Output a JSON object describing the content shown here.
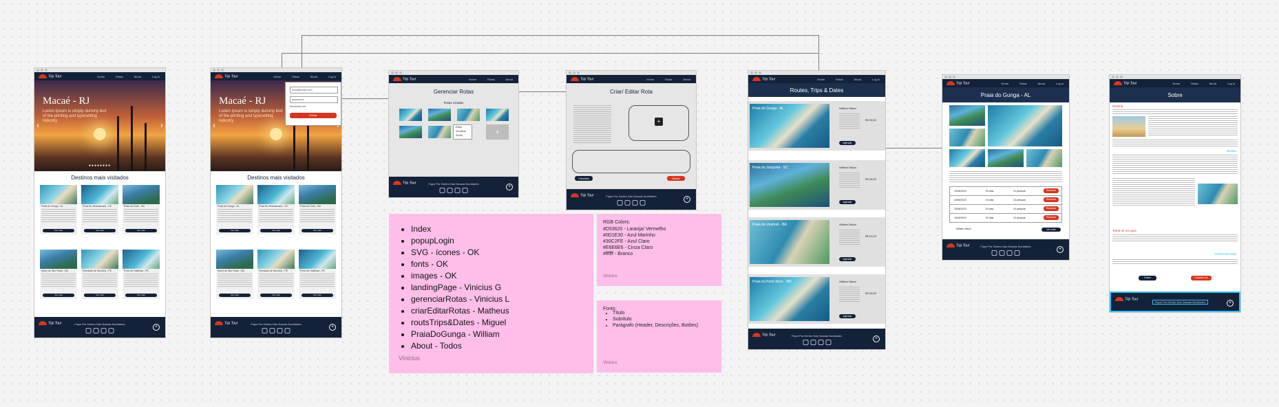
{
  "nav": {
    "home": "Home",
    "routes": "Rotas",
    "about": "About",
    "login": "Log in"
  },
  "footer": {
    "tagline": "Fique Por Dentro Das Nossas Novidades",
    "brand": "Trip Tour",
    "contact": "WhatsApp"
  },
  "landing": {
    "hero_title": "Macaé - RJ",
    "hero_subtitle": "Lorem Ipsum is simply dummy text of the printing and typesetting industry.",
    "section_title": "Destinos mais visitados",
    "cards": [
      {
        "title": "Praia do Gunga - AL"
      },
      {
        "title": "Praia de Jericoacoara - CE"
      },
      {
        "title": "Praia do Forte - BA"
      },
      {
        "title": "Morro de São Paulo - BA"
      },
      {
        "title": "Fernando de Noronha - PE"
      },
      {
        "title": "Porto de Galinhas - PE"
      }
    ],
    "card_button": "Ver mais"
  },
  "login_popup": {
    "email_placeholder": "email@mail.com",
    "password_placeholder": "password",
    "remember": "Remember me",
    "button": "Entrar"
  },
  "manage": {
    "title": "Gerenciar Rotas",
    "subtitle": "Rotas Criadas",
    "menu": [
      "Editar",
      "Visualizar",
      "Excluir"
    ]
  },
  "create": {
    "title": "Criar/ Editar Rota",
    "cancel": "Cancelar",
    "save": "Salvar"
  },
  "routes": {
    "title": "Routes, Trips & Dates",
    "items": [
      {
        "name": "Praia do Gunga - AL",
        "guide": "William Nilson",
        "price": "R$ 250,00",
        "button": "Agendar"
      },
      {
        "name": "Praia da Joaquina - SC",
        "guide": "William Nilson",
        "price": "R$ 180,00",
        "button": "Agendar"
      },
      {
        "name": "Praia de Unamuti - BA",
        "guide": "William Nilson",
        "price": "R$ 210,00",
        "button": "Agendar"
      },
      {
        "name": "Praia do Porto Novo - RN",
        "guide": "William Nilson",
        "price": "R$ 320,00",
        "button": "Agendar"
      }
    ]
  },
  "gunga": {
    "title": "Praia do Gunga - AL",
    "table": [
      {
        "date": "15/06/2023",
        "days": "03 dias",
        "people": "10 pessoas",
        "button": "Reservar"
      },
      {
        "date": "15/06/2023",
        "days": "03 dias",
        "people": "10 pessoas",
        "button": "Reservar"
      },
      {
        "date": "15/06/2023",
        "days": "03 dias",
        "people": "10 pessoas",
        "button": "Reservar"
      },
      {
        "date": "15/06/2023",
        "days": "03 dias",
        "people": "10 pessoas",
        "button": "Reservar"
      }
    ],
    "guide": "William Nilson",
    "more": "Ver mais"
  },
  "about": {
    "title": "Sobre",
    "history": "História",
    "mission": "Missão",
    "join": "Torne-se um guia",
    "contact": "CONTATE-NOS",
    "btn_left": "Entrar",
    "btn_right": "Cadastre-se"
  },
  "notes": {
    "list": [
      "Index",
      "popupLogin",
      "SVG - ícones - OK",
      "fonts - OK",
      "images - OK",
      "landingPage - Vinicius G",
      "gerenciarRotas - Vinicius L",
      "criarEditarRotas - Matheus",
      "routsTrips&Dates - Miguel",
      "PraiaDoGunga - William",
      "About - Todos"
    ],
    "list_author": "Vinicius",
    "colors_title": "RGB Colors:",
    "colors": [
      "#D53620 - Laranja/ Vermelho",
      "#0D1E30 - Azul Marinho",
      "#30C2FE - Azul Claro",
      "#E6E6E6 - Cinza Claro",
      "#ffffff - Branco"
    ],
    "colors_author": "Vinicius",
    "fonts_title": "Fonts:",
    "fonts": [
      "Título",
      "Subtítulo",
      "Parágrafo (Header, Descrições, Botões)"
    ],
    "fonts_author": "Vinicius"
  },
  "colors": {
    "accent": "#D53620",
    "navy": "#0D1E30",
    "light_blue": "#30C2FE",
    "light_gray": "#E6E6E6",
    "note_pink": "#FFBDE9"
  }
}
